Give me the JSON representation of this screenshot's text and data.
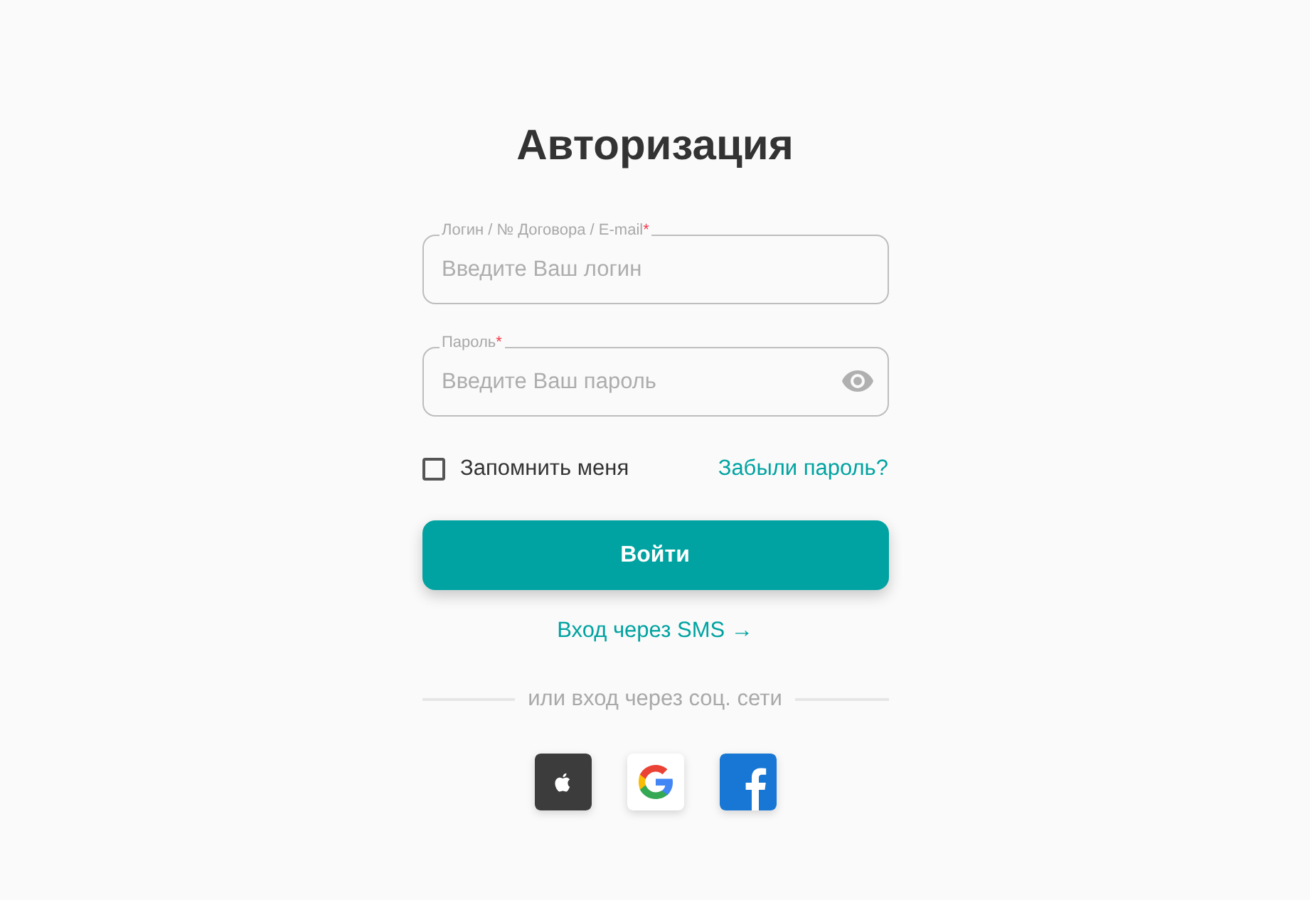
{
  "title": "Авторизация",
  "fields": [
    {
      "kind": "text",
      "label": "Логин / № Договора / E-mail",
      "required_mark": "*",
      "placeholder": "Введите Ваш логин"
    },
    {
      "kind": "password",
      "label": "Пароль",
      "required_mark": "*",
      "placeholder": "Введите Ваш пароль"
    }
  ],
  "remember": {
    "label": "Запомнить меня",
    "checked": false
  },
  "forgot_link": "Забыли пароль?",
  "submit_button": "Войти",
  "sms_link": "Вход через SMS →",
  "divider_text": "или вход через соц. сети",
  "social": [
    {
      "kind": "apple"
    },
    {
      "kind": "google"
    },
    {
      "kind": "facebook"
    }
  ]
}
